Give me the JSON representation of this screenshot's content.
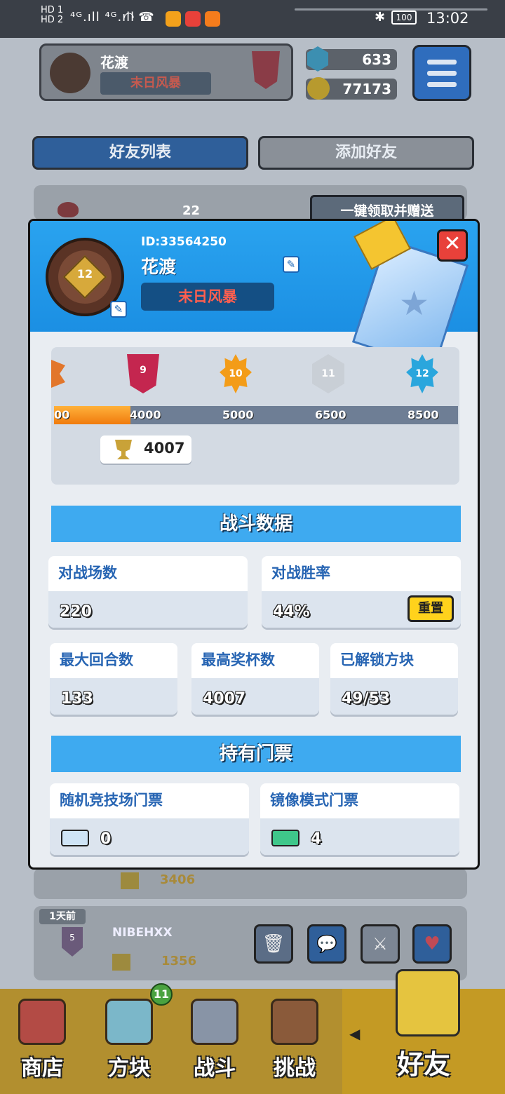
{
  "status_bar": {
    "hd_top": "HD 1",
    "hd_bottom": "HD 2",
    "signal": "⁴ᴳ.ıll ⁴ᴳ.ıll",
    "battery": "100",
    "time": "13:02"
  },
  "background": {
    "player_name": "花渡",
    "clan": "末日风暴",
    "gems": "633",
    "coins": "77173",
    "tab_friends": "好友列表",
    "tab_add": "添加好友",
    "heart_count": "22",
    "claim_all": "一键领取并赠送",
    "row1_trophies": "3406",
    "row2_time": "1天前",
    "row2_name": "NIBEHXX",
    "row2_trophies": "1356",
    "row2_rank": "5"
  },
  "nav": {
    "shop": "商店",
    "blocks": "方块",
    "blocks_badge": "11",
    "battle": "战斗",
    "challenge": "挑战",
    "friends": "好友"
  },
  "modal": {
    "player_id": "ID:33564250",
    "player_name": "花渡",
    "clan": "末日风暴",
    "avatar_rank": "12",
    "close": "✕",
    "progress": {
      "ranks": [
        "9",
        "10",
        "11",
        "12"
      ],
      "ticks": [
        "00",
        "4000",
        "5000",
        "6500",
        "8500"
      ],
      "current_trophies": "4007",
      "fill_fraction": 0.19
    },
    "battle_section": "战斗数据",
    "stats": {
      "matches_label": "对战场数",
      "matches_value": "220",
      "winrate_label": "对战胜率",
      "winrate_value": "44%",
      "reset": "重置",
      "max_rounds_label": "最大回合数",
      "max_rounds_value": "133",
      "max_trophies_label": "最高奖杯数",
      "max_trophies_value": "4007",
      "unlocked_label": "已解锁方块",
      "unlocked_value": "49/53"
    },
    "tickets_section": "持有门票",
    "tickets": {
      "arena_label": "随机竞技场门票",
      "arena_value": "0",
      "mirror_label": "镜像模式门票",
      "mirror_value": "4"
    }
  }
}
